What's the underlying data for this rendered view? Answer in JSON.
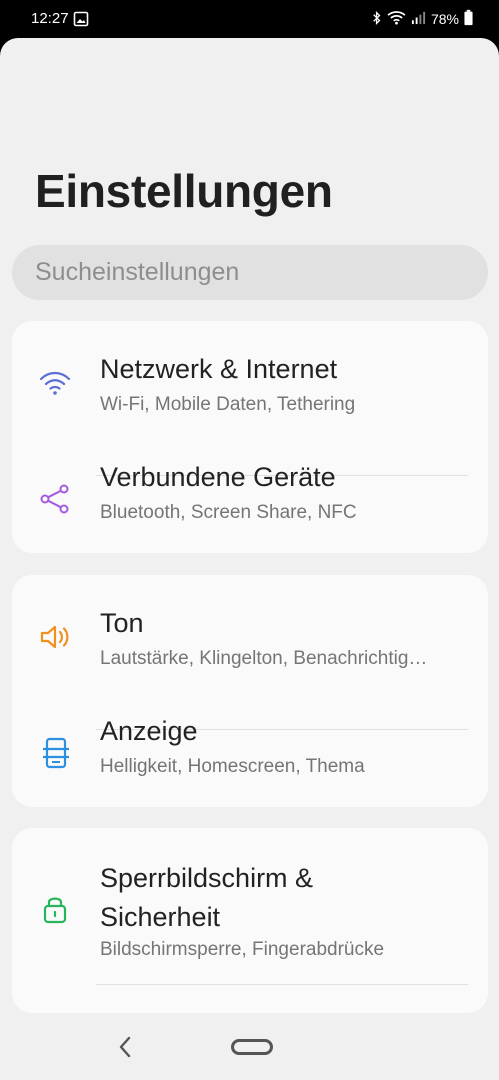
{
  "status_bar": {
    "time": "12:27",
    "battery_text": "78%",
    "icons": [
      "gallery-icon",
      "bluetooth-icon",
      "wifi-icon",
      "signal-icon",
      "battery-icon"
    ]
  },
  "page": {
    "title": "Einstellungen",
    "search_placeholder": "Sucheinstellungen"
  },
  "groups": [
    {
      "items": [
        {
          "title": "Netzwerk & Internet",
          "subtitle": "Wi-Fi, Mobile Daten, Tethering",
          "icon": "wifi-icon",
          "color": "#5b6fd6"
        },
        {
          "title": "Verbundene Geräte",
          "subtitle": "Bluetooth, Screen Share, NFC",
          "icon": "share-icon",
          "color": "#a55be0"
        }
      ]
    },
    {
      "items": [
        {
          "title": "Ton",
          "subtitle": "Lautstärke, Klingelton, Benachrichtig…",
          "icon": "speaker-icon",
          "color": "#f0901e"
        },
        {
          "title": "Anzeige",
          "subtitle": "Helligkeit, Homescreen, Thema",
          "icon": "display-icon",
          "color": "#2d8fe0"
        }
      ]
    },
    {
      "items": [
        {
          "title_line1": "Sperrbildschirm &",
          "title_line2": "Sicherheit",
          "subtitle": "Bildschirmsperre, Fingerabdrücke",
          "icon": "lock-icon",
          "color": "#27b45a"
        }
      ]
    }
  ],
  "nav_bar": {
    "buttons": [
      "back-button",
      "home-button"
    ]
  }
}
